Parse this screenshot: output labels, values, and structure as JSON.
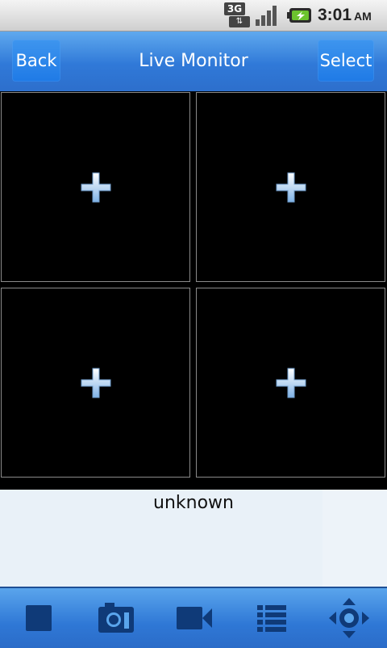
{
  "status_bar": {
    "network": "3G",
    "network_arrows": "⇅",
    "time": "3:01",
    "ampm": "AM",
    "icons": [
      "network-3g-icon",
      "signal-icon",
      "battery-charging-icon"
    ]
  },
  "title_bar": {
    "back_label": "Back",
    "title": "Live Monitor",
    "select_label": "Select"
  },
  "grid": {
    "cells": [
      {
        "icon": "add-camera-icon"
      },
      {
        "icon": "add-camera-icon"
      },
      {
        "icon": "add-camera-icon"
      },
      {
        "icon": "add-camera-icon"
      }
    ]
  },
  "info": {
    "text": "unknown"
  },
  "toolbar": {
    "items": [
      {
        "icon": "stop-icon"
      },
      {
        "icon": "camera-snapshot-icon"
      },
      {
        "icon": "video-record-icon"
      },
      {
        "icon": "list-icon"
      },
      {
        "icon": "ptz-control-icon"
      }
    ]
  },
  "colors": {
    "accent": "#2f78d6",
    "icon_dark": "#0f3a78"
  }
}
